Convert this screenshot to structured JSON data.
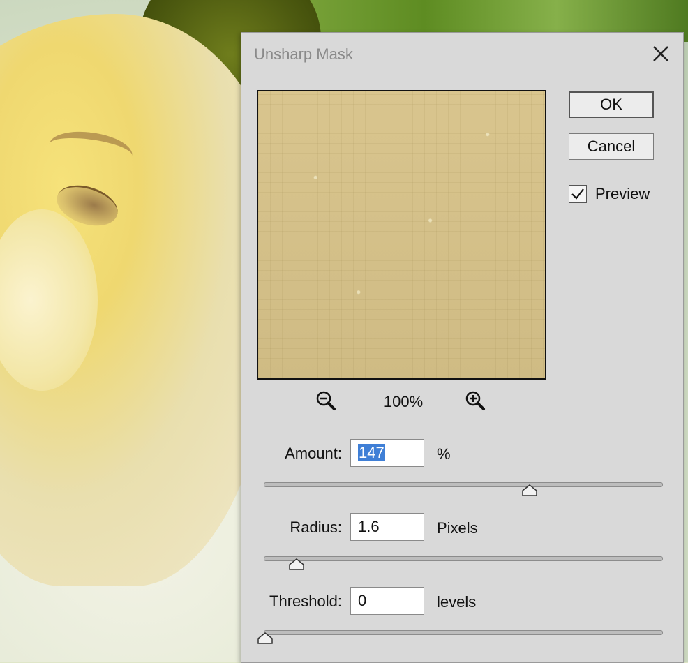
{
  "dialog": {
    "title": "Unsharp Mask",
    "ok_label": "OK",
    "cancel_label": "Cancel",
    "preview_label": "Preview",
    "preview_checked": true,
    "zoom_level": "100%"
  },
  "fields": {
    "amount": {
      "label": "Amount:",
      "value": "147",
      "unit": "%",
      "slider_fraction": 0.67
    },
    "radius": {
      "label": "Radius:",
      "value": "1.6",
      "unit": "Pixels",
      "slider_fraction": 0.08
    },
    "threshold": {
      "label": "Threshold:",
      "value": "0",
      "unit": "levels",
      "slider_fraction": 0.0
    }
  },
  "colors": {
    "selection": "#3f7fd6",
    "dialog_bg": "#d9d9d9"
  },
  "icons": [
    "close-icon",
    "zoom-out-icon",
    "zoom-in-icon",
    "checkmark-icon",
    "slider-thumb-icon"
  ]
}
